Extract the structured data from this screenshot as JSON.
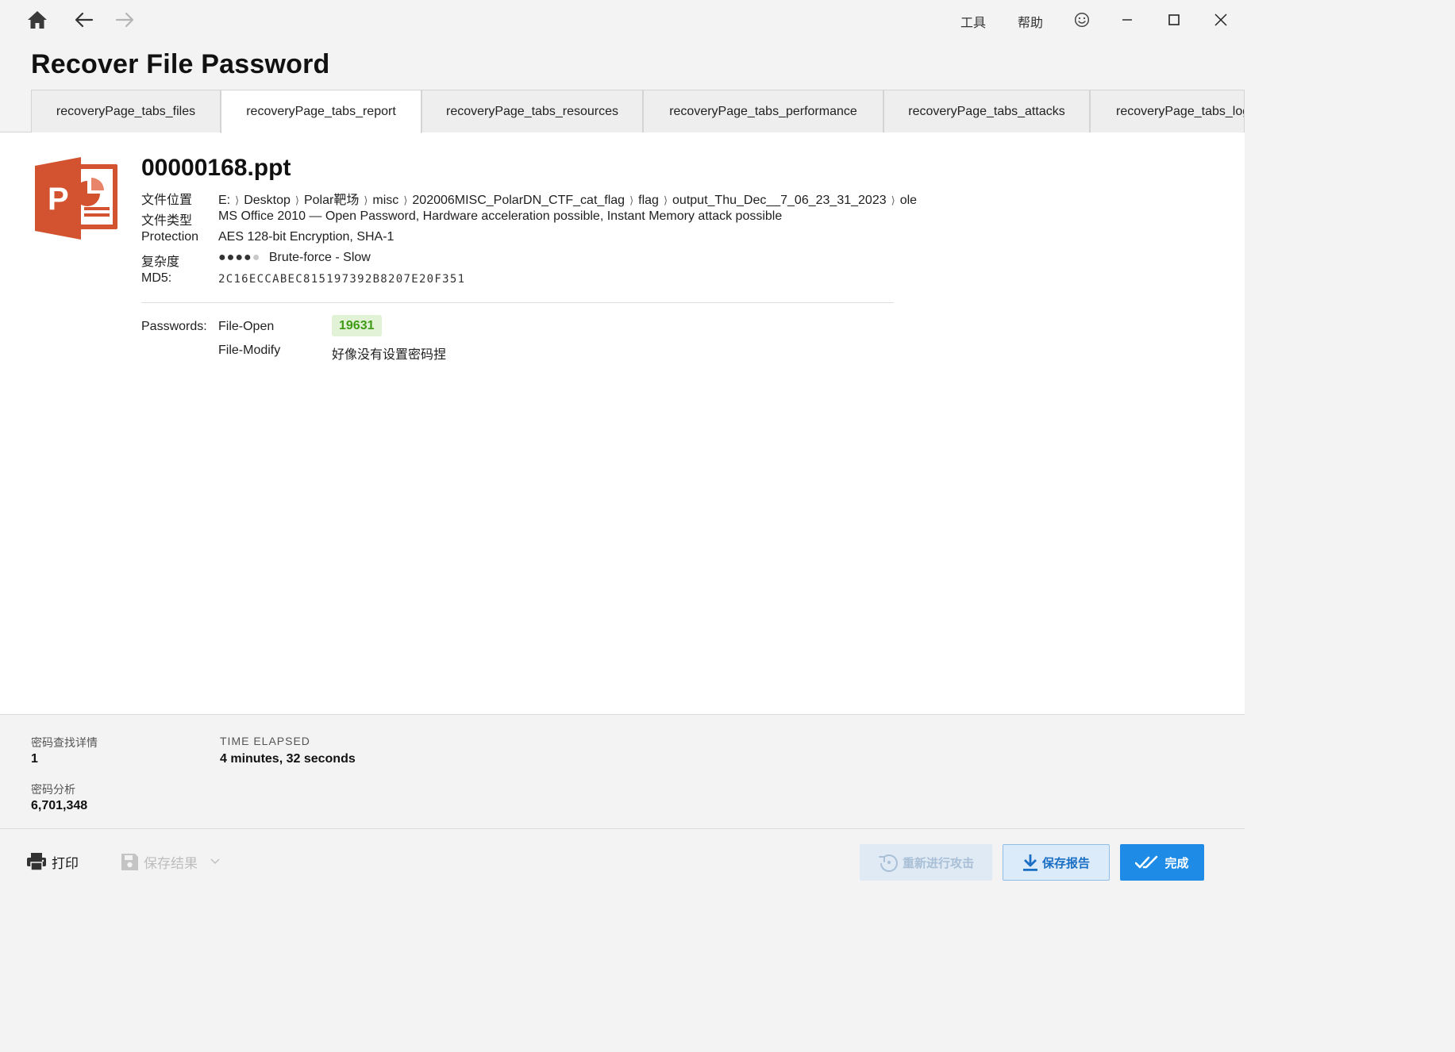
{
  "topbar": {
    "menu_tools": "工具",
    "menu_help": "帮助"
  },
  "page": {
    "title": "Recover File Password"
  },
  "tabs": [
    {
      "label": "recoveryPage_tabs_files"
    },
    {
      "label": "recoveryPage_tabs_report",
      "active": true
    },
    {
      "label": "recoveryPage_tabs_resources"
    },
    {
      "label": "recoveryPage_tabs_performance"
    },
    {
      "label": "recoveryPage_tabs_attacks"
    },
    {
      "label": "recoveryPage_tabs_log"
    }
  ],
  "file": {
    "name": "00000168.ppt",
    "icon": "powerpoint-icon",
    "icon_letter": "P",
    "location_label": "文件位置",
    "location_parts": [
      "E:",
      "Desktop",
      "Polar靶场",
      "misc",
      "202006MISC_PolarDN_CTF_cat_flag",
      "flag",
      "output_Thu_Dec__7_06_23_31_2023",
      "ole"
    ],
    "type_label": "文件类型",
    "type_value": "MS Office 2010 — Open Password, Hardware acceleration possible, Instant Memory attack possible",
    "protection_label": "Protection",
    "protection_value": "AES 128-bit Encryption, SHA-1",
    "complexity_label": "复杂度",
    "complexity_level": 4,
    "complexity_max": 5,
    "complexity_value": "Brute-force - Slow",
    "md5_label": "MD5:",
    "md5_value": "2C16ECCABEC815197392B8207E20F351"
  },
  "passwords": {
    "label": "Passwords:",
    "open_type": "File-Open",
    "open_value": "19631",
    "modify_type": "File-Modify",
    "modify_value": "好像没有设置密码捏"
  },
  "stats": {
    "found_label": "密码查找详情",
    "found_value": "1",
    "analyzed_label": "密码分析",
    "analyzed_value": "6,701,348",
    "time_label": "TIME ELAPSED",
    "time_value": "4 minutes, 32 seconds"
  },
  "footer": {
    "print_label": "打印",
    "save_results_label": "保存结果",
    "retry_label": "重新进行攻击",
    "save_report_label": "保存报告",
    "done_label": "完成"
  },
  "colors": {
    "accent": "#1e8be6",
    "powerpoint": "#d35230",
    "password_badge_bg": "#e2f2d6",
    "password_badge_text": "#3f9a16"
  }
}
